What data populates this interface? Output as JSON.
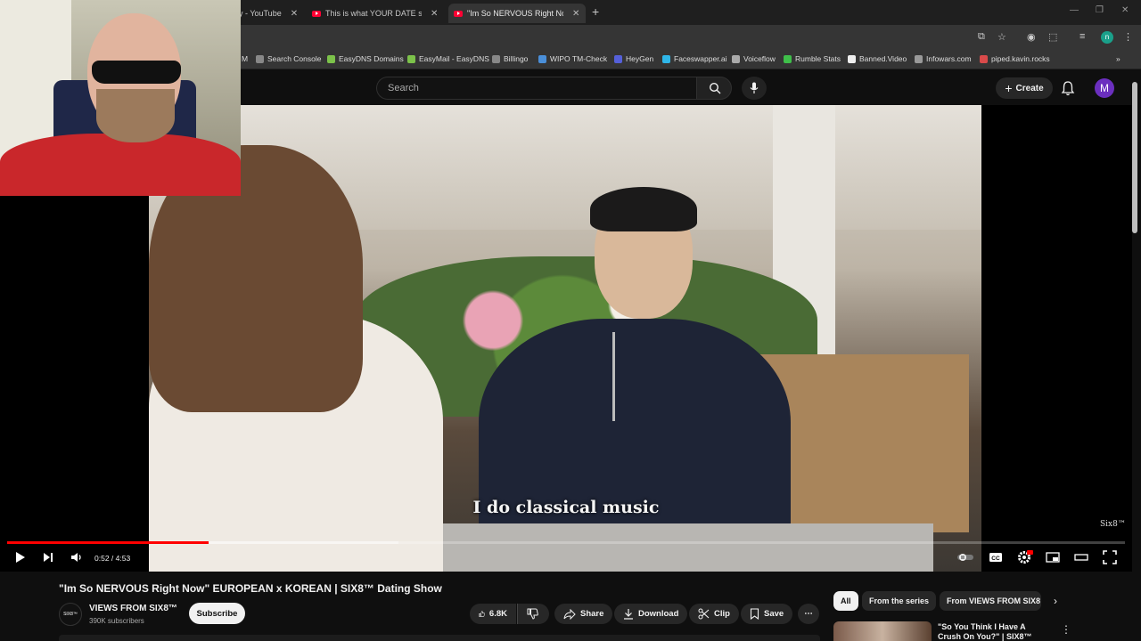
{
  "browser": {
    "tabs": [
      {
        "title": "y - YouTube",
        "active": false
      },
      {
        "title": "This is what YOUR DATE should",
        "active": false
      },
      {
        "title": "\"Im So NERVOUS Right Now\" E",
        "active": true
      }
    ],
    "bookmarks": [
      "M",
      "Search Console",
      "EasyDNS Domains",
      "EasyMail - EasyDNS",
      "Billingo",
      "WIPO TM-Check",
      "HeyGen",
      "Faceswapper.ai",
      "Voiceflow",
      "Rumble Stats",
      "Banned.Video",
      "Infowars.com",
      "piped.kavin.rocks"
    ],
    "profile_initial": "n"
  },
  "masthead": {
    "search_placeholder": "Search",
    "create_label": "Create",
    "user_initial": "M"
  },
  "player": {
    "caption": "I do classical music",
    "watermark": "Six8™",
    "time": "0:52 / 4:53",
    "progress": 0.18,
    "buffered": 0.35
  },
  "video": {
    "title": "\"Im So NERVOUS Right Now\" EUROPEAN x KOREAN | SIX8™ Dating Show",
    "channel_name": "VIEWS FROM SIX8™",
    "subscribers": "390K subscribers",
    "channel_avatar_text": "SIX8™",
    "subscribe_label": "Subscribe",
    "likes": "6.8K",
    "share_label": "Share",
    "download_label": "Download",
    "clip_label": "Clip",
    "save_label": "Save"
  },
  "sidebar": {
    "chips": [
      "All",
      "From the series",
      "From VIEWS FROM SIX8"
    ],
    "recommendation_title": "\"So You Think I Have A Crush On You?\" | SIX8™ Dating Show"
  },
  "colors": {
    "accent": "#ff0000",
    "avatar": "#6b2fbf",
    "background": "#0f0f0f"
  }
}
